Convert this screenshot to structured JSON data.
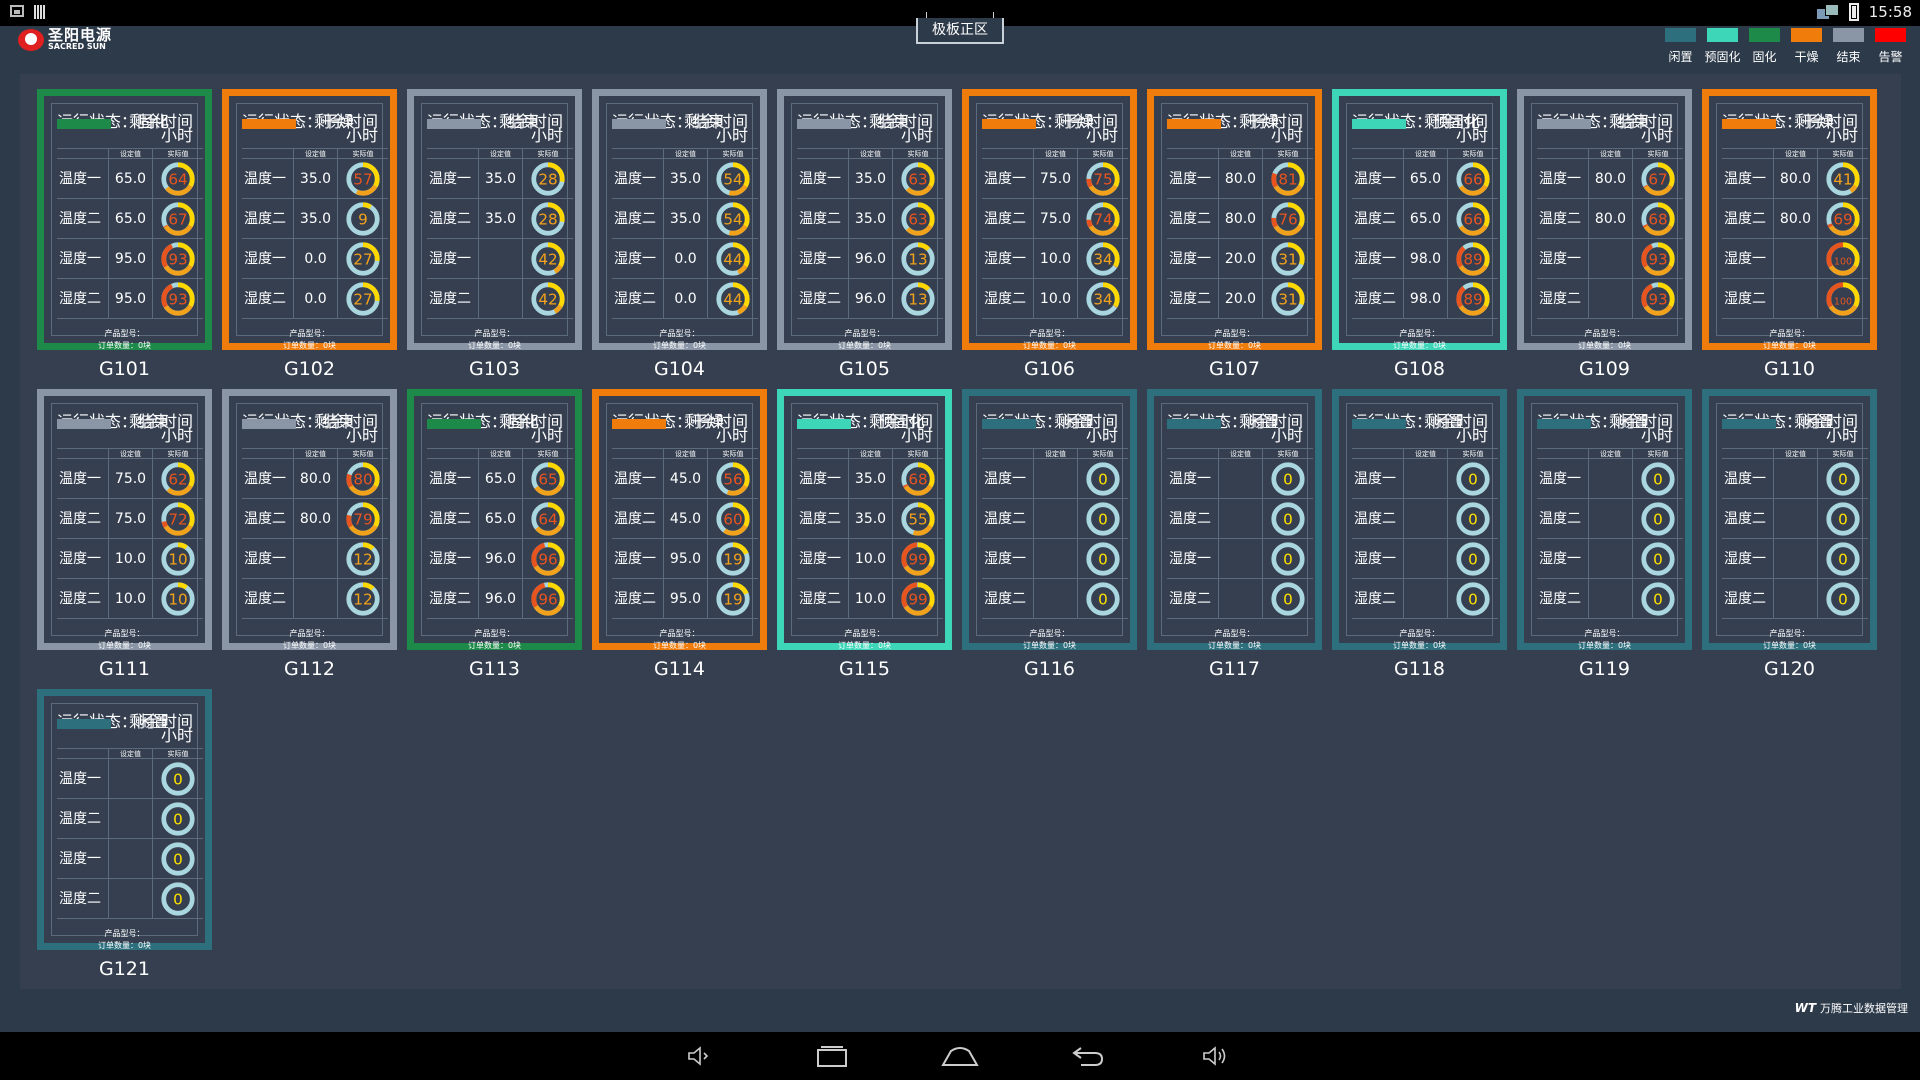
{
  "statusbar": {
    "time": "15:58"
  },
  "header": {
    "logo_cn": "圣阳电源",
    "logo_en": "SACRED SUN",
    "zone_title": "极板正区"
  },
  "legend": [
    {
      "label": "闲置",
      "color": "#2e6f7e"
    },
    {
      "label": "预固化",
      "color": "#3dd6b8"
    },
    {
      "label": "固化",
      "color": "#1e8a4a"
    },
    {
      "label": "干燥",
      "color": "#f07c0c"
    },
    {
      "label": "结束",
      "color": "#8a96a6"
    },
    {
      "label": "告警",
      "color": "#ff0000"
    }
  ],
  "labels": {
    "remain_label": "剩余时间",
    "hours": "小时",
    "col_set": "设定值",
    "col_actual": "实际值",
    "product_model": "产品型号：",
    "order_qty": "订单数量：0块"
  },
  "row_labels": [
    "温度一",
    "温度二",
    "湿度一",
    "湿度二"
  ],
  "machines": [
    {
      "name": "G101",
      "status": "运行状态：固化",
      "color": "#1e8a4a",
      "set": [
        "65.0",
        "65.0",
        "95.0",
        "95.0"
      ],
      "actual": [
        "64",
        "67",
        "93",
        "93"
      ]
    },
    {
      "name": "G102",
      "status": "运行状态：干燥",
      "color": "#f07c0c",
      "set": [
        "35.0",
        "35.0",
        "0.0",
        "0.0"
      ],
      "actual": [
        "57",
        "9",
        "27",
        "27"
      ]
    },
    {
      "name": "G103",
      "status": "运行状态：结束",
      "color": "#8a96a6",
      "set": [
        "35.0",
        "35.0",
        "",
        ""
      ],
      "actual": [
        "28",
        "28",
        "42",
        "42"
      ]
    },
    {
      "name": "G104",
      "status": "运行状态：结束",
      "color": "#8a96a6",
      "set": [
        "35.0",
        "35.0",
        "0.0",
        "0.0"
      ],
      "actual": [
        "54",
        "54",
        "44",
        "44"
      ]
    },
    {
      "name": "G105",
      "status": "运行状态：结束",
      "color": "#8a96a6",
      "set": [
        "35.0",
        "35.0",
        "96.0",
        "96.0"
      ],
      "actual": [
        "63",
        "63",
        "13",
        "13"
      ]
    },
    {
      "name": "G106",
      "status": "运行状态：干燥",
      "color": "#f07c0c",
      "set": [
        "75.0",
        "75.0",
        "10.0",
        "10.0"
      ],
      "actual": [
        "75",
        "74",
        "34",
        "34"
      ]
    },
    {
      "name": "G107",
      "status": "运行状态：干燥",
      "color": "#f07c0c",
      "set": [
        "80.0",
        "80.0",
        "20.0",
        "20.0"
      ],
      "actual": [
        "81",
        "76",
        "31",
        "31"
      ]
    },
    {
      "name": "G108",
      "status": "运行状态：预固化",
      "color": "#3dd6b8",
      "set": [
        "65.0",
        "65.0",
        "98.0",
        "98.0"
      ],
      "actual": [
        "66",
        "66",
        "89",
        "89"
      ]
    },
    {
      "name": "G109",
      "status": "运行状态：结束",
      "color": "#8a96a6",
      "set": [
        "80.0",
        "80.0",
        "",
        ""
      ],
      "actual": [
        "67",
        "68",
        "93",
        "93"
      ]
    },
    {
      "name": "G110",
      "status": "运行状态：干燥",
      "color": "#f07c0c",
      "set": [
        "80.0",
        "80.0",
        "",
        ""
      ],
      "actual": [
        "41",
        "69",
        "100",
        "100"
      ]
    },
    {
      "name": "G111",
      "status": "运行状态：结束",
      "color": "#8a96a6",
      "set": [
        "75.0",
        "75.0",
        "10.0",
        "10.0"
      ],
      "actual": [
        "62",
        "72",
        "10",
        "10"
      ]
    },
    {
      "name": "G112",
      "status": "运行状态：结束",
      "color": "#8a96a6",
      "set": [
        "80.0",
        "80.0",
        "",
        ""
      ],
      "actual": [
        "80",
        "79",
        "12",
        "12"
      ]
    },
    {
      "name": "G113",
      "status": "运行状态：固化",
      "color": "#1e8a4a",
      "set": [
        "65.0",
        "65.0",
        "96.0",
        "96.0"
      ],
      "actual": [
        "65",
        "64",
        "96",
        "96"
      ]
    },
    {
      "name": "G114",
      "status": "运行状态：干燥",
      "color": "#f07c0c",
      "set": [
        "45.0",
        "45.0",
        "95.0",
        "95.0"
      ],
      "actual": [
        "56",
        "60",
        "19",
        "19"
      ]
    },
    {
      "name": "G115",
      "status": "运行状态：预固化",
      "color": "#3dd6b8",
      "set": [
        "35.0",
        "35.0",
        "10.0",
        "10.0"
      ],
      "actual": [
        "68",
        "55",
        "99",
        "99"
      ]
    },
    {
      "name": "G116",
      "status": "运行状态：闲置",
      "color": "#2e6f7e",
      "set": [
        "",
        "",
        "",
        ""
      ],
      "actual": [
        "0",
        "0",
        "0",
        "0"
      ]
    },
    {
      "name": "G117",
      "status": "运行状态：闲置",
      "color": "#2e6f7e",
      "set": [
        "",
        "",
        "",
        ""
      ],
      "actual": [
        "0",
        "0",
        "0",
        "0"
      ]
    },
    {
      "name": "G118",
      "status": "运行状态：闲置",
      "color": "#2e6f7e",
      "set": [
        "",
        "",
        "",
        ""
      ],
      "actual": [
        "0",
        "0",
        "0",
        "0"
      ]
    },
    {
      "name": "G119",
      "status": "运行状态：闲置",
      "color": "#2e6f7e",
      "set": [
        "",
        "",
        "",
        ""
      ],
      "actual": [
        "0",
        "0",
        "0",
        "0"
      ]
    },
    {
      "name": "G120",
      "status": "运行状态：闲置",
      "color": "#2e6f7e",
      "set": [
        "",
        "",
        "",
        ""
      ],
      "actual": [
        "0",
        "0",
        "0",
        "0"
      ]
    },
    {
      "name": "G121",
      "status": "运行状态：闲置",
      "color": "#2e6f7e",
      "set": [
        "",
        "",
        "",
        ""
      ],
      "actual": [
        "0",
        "0",
        "0",
        "0"
      ]
    }
  ],
  "brand": {
    "mark": "WT",
    "text": "万腾工业数据管理"
  },
  "navbar": {
    "icons": [
      "volume-down-icon",
      "recent-apps-icon",
      "home-icon",
      "back-icon",
      "volume-up-icon"
    ]
  }
}
